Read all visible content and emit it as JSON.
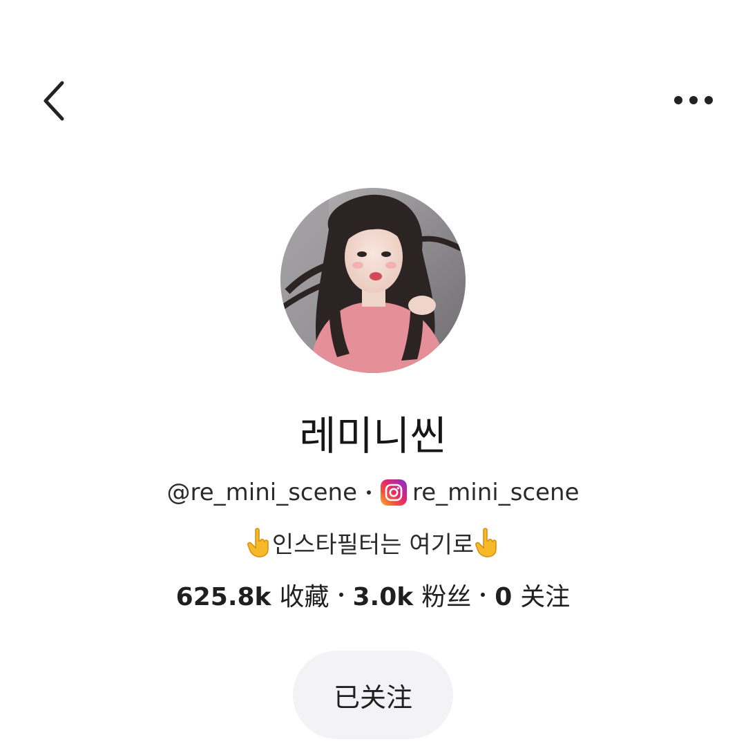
{
  "nav": {
    "back_icon": "chevron-left-icon",
    "more_icon": "more-horizontal-icon"
  },
  "profile": {
    "display_name": "레미니씬",
    "handle": "@re_mini_scene",
    "instagram_icon": "instagram-icon",
    "instagram_handle": "re_mini_scene",
    "bio_text": "인스타필터는 여기로",
    "bio_icon": "pointing-hand-emoji",
    "avatar_overlay_text": "",
    "colors": {
      "instagram_gradient": [
        "#f9b233",
        "#e4286a",
        "#6a3ad2"
      ],
      "button_bg": "#f3f3f5"
    }
  },
  "stats": [
    {
      "value": "625.8k",
      "label": "收藏"
    },
    {
      "value": "3.0k",
      "label": "粉丝"
    },
    {
      "value": "0",
      "label": "关注"
    }
  ],
  "follow_button": {
    "label": "已关注"
  }
}
